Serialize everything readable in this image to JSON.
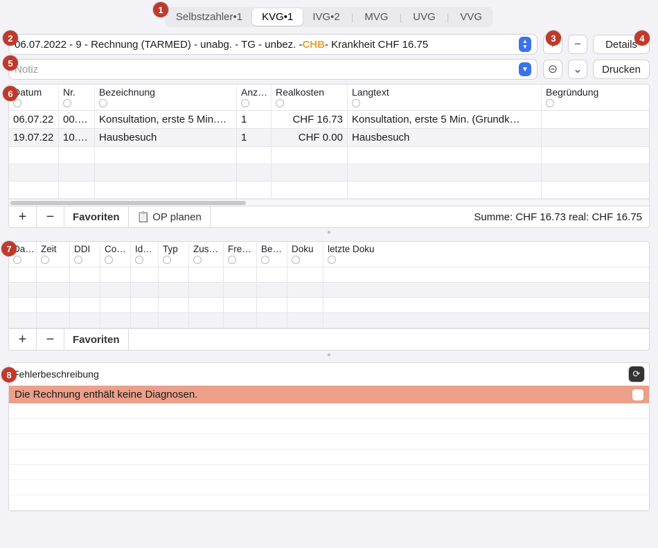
{
  "badges": [
    "1",
    "2",
    "3",
    "4",
    "5",
    "6",
    "7",
    "8"
  ],
  "tabs": {
    "items": [
      {
        "label": "Selbstzahler•1"
      },
      {
        "label": "KVG•1",
        "active": true
      },
      {
        "label": "IVG•2"
      },
      {
        "label": "MVG"
      },
      {
        "label": "UVG"
      },
      {
        "label": "VVG"
      }
    ]
  },
  "selector": {
    "prefix": "06.07.2022 - 9 - Rechnung (TARMED) - unabg. - TG - unbez. - ",
    "highlight": "CHB",
    "suffix": " - Krankheit CHF 16.75"
  },
  "buttons": {
    "plus": "+",
    "minus": "−",
    "details": "Details",
    "print": "Drucken",
    "recycle": "⊝",
    "chevron": "⌄"
  },
  "note": {
    "placeholder": "Notiz"
  },
  "services": {
    "headers": [
      "Datum",
      "Nr.",
      "Bezeichnung",
      "Anz…",
      "Realkosten",
      "Langtext",
      "Begründung"
    ],
    "rows": [
      {
        "datum": "06.07.22",
        "nr": "00.0…",
        "bez": "Konsultation, erste 5 Min.…",
        "anz": "1",
        "kosten": "CHF 16.73",
        "lang": "Konsultation, erste 5 Min. (Grundk…",
        "begr": ""
      },
      {
        "datum": "19.07.22",
        "nr": "10.0…",
        "bez": "Hausbesuch",
        "anz": "1",
        "kosten": "CHF 0.00",
        "lang": "Hausbesuch",
        "begr": ""
      }
    ],
    "footer": {
      "favoriten": "Favoriten",
      "opplanen": "OP planen",
      "summe": "Summe: CHF 16.73 real: CHF 16.75"
    }
  },
  "details_table": {
    "headers": [
      "Da…",
      "Zeit",
      "DDI",
      "Co…",
      "Id…",
      "Typ",
      "Zus…",
      "Fre…",
      "Be…",
      "Doku",
      "letzte Doku"
    ]
  },
  "details_footer": {
    "favoriten": "Favoriten"
  },
  "errors": {
    "title": "Fehlerbeschreibung",
    "rows": [
      {
        "text": "Die Rechnung enthält keine Diagnosen.",
        "error": true
      }
    ]
  }
}
